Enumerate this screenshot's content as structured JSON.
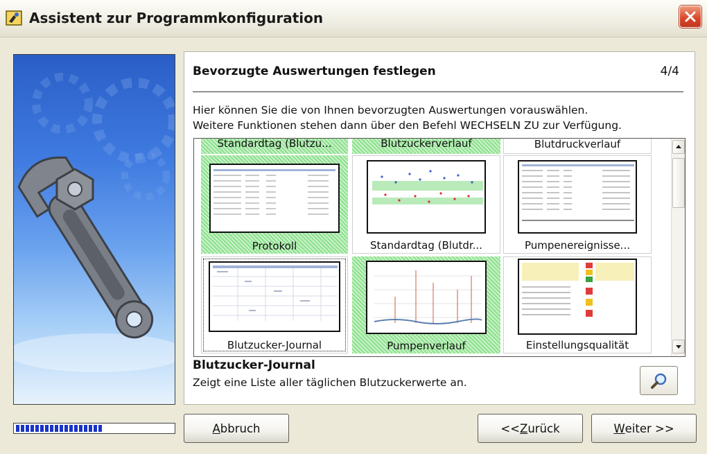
{
  "window": {
    "title": "Assistent zur Programmkonfiguration",
    "icon": "wizard-icon",
    "close_icon": "close-icon"
  },
  "header": {
    "title": "Bevorzugte Auswertungen festlegen",
    "step": "4/4"
  },
  "description": [
    "Hier können Sie die von Ihnen bevorzugten Auswertungen vorauswählen.",
    "Weitere Funktionen stehen dann über den Befehl WECHSELN ZU zur Verfügung."
  ],
  "gallery": {
    "tiles": [
      {
        "label": "Standardtag (Blutzu...",
        "selected": true
      },
      {
        "label": "Blutzuckerverlauf",
        "selected": true
      },
      {
        "label": "Blutdruckverlauf",
        "selected": false
      },
      {
        "label": "Protokoll",
        "selected": true
      },
      {
        "label": "Standardtag (Blutdr...",
        "selected": false
      },
      {
        "label": "Pumpenereignisse...",
        "selected": false
      },
      {
        "label": "Blutzucker-Journal",
        "selected": false,
        "focused": true
      },
      {
        "label": "Pumpenverlauf",
        "selected": true
      },
      {
        "label": "Einstellungsqualität",
        "selected": false
      }
    ]
  },
  "selected_item": {
    "title": "Blutzucker-Journal",
    "description": "Zeigt eine Liste aller täglichen Blutzuckerwerte an."
  },
  "zoom_icon": "magnifier-icon",
  "progress": {
    "fraction": 0.55
  },
  "buttons": {
    "cancel": {
      "before": "",
      "mnemonic": "A",
      "after": "bbruch"
    },
    "back": {
      "before": "<< ",
      "mnemonic": "Z",
      "after": "urück"
    },
    "next": {
      "before": "",
      "mnemonic": "W",
      "after": "eiter >>"
    }
  },
  "colors": {
    "selection_green": "#8de08d",
    "progress_blue": "#1933c8",
    "close_red": "#d6462a"
  }
}
